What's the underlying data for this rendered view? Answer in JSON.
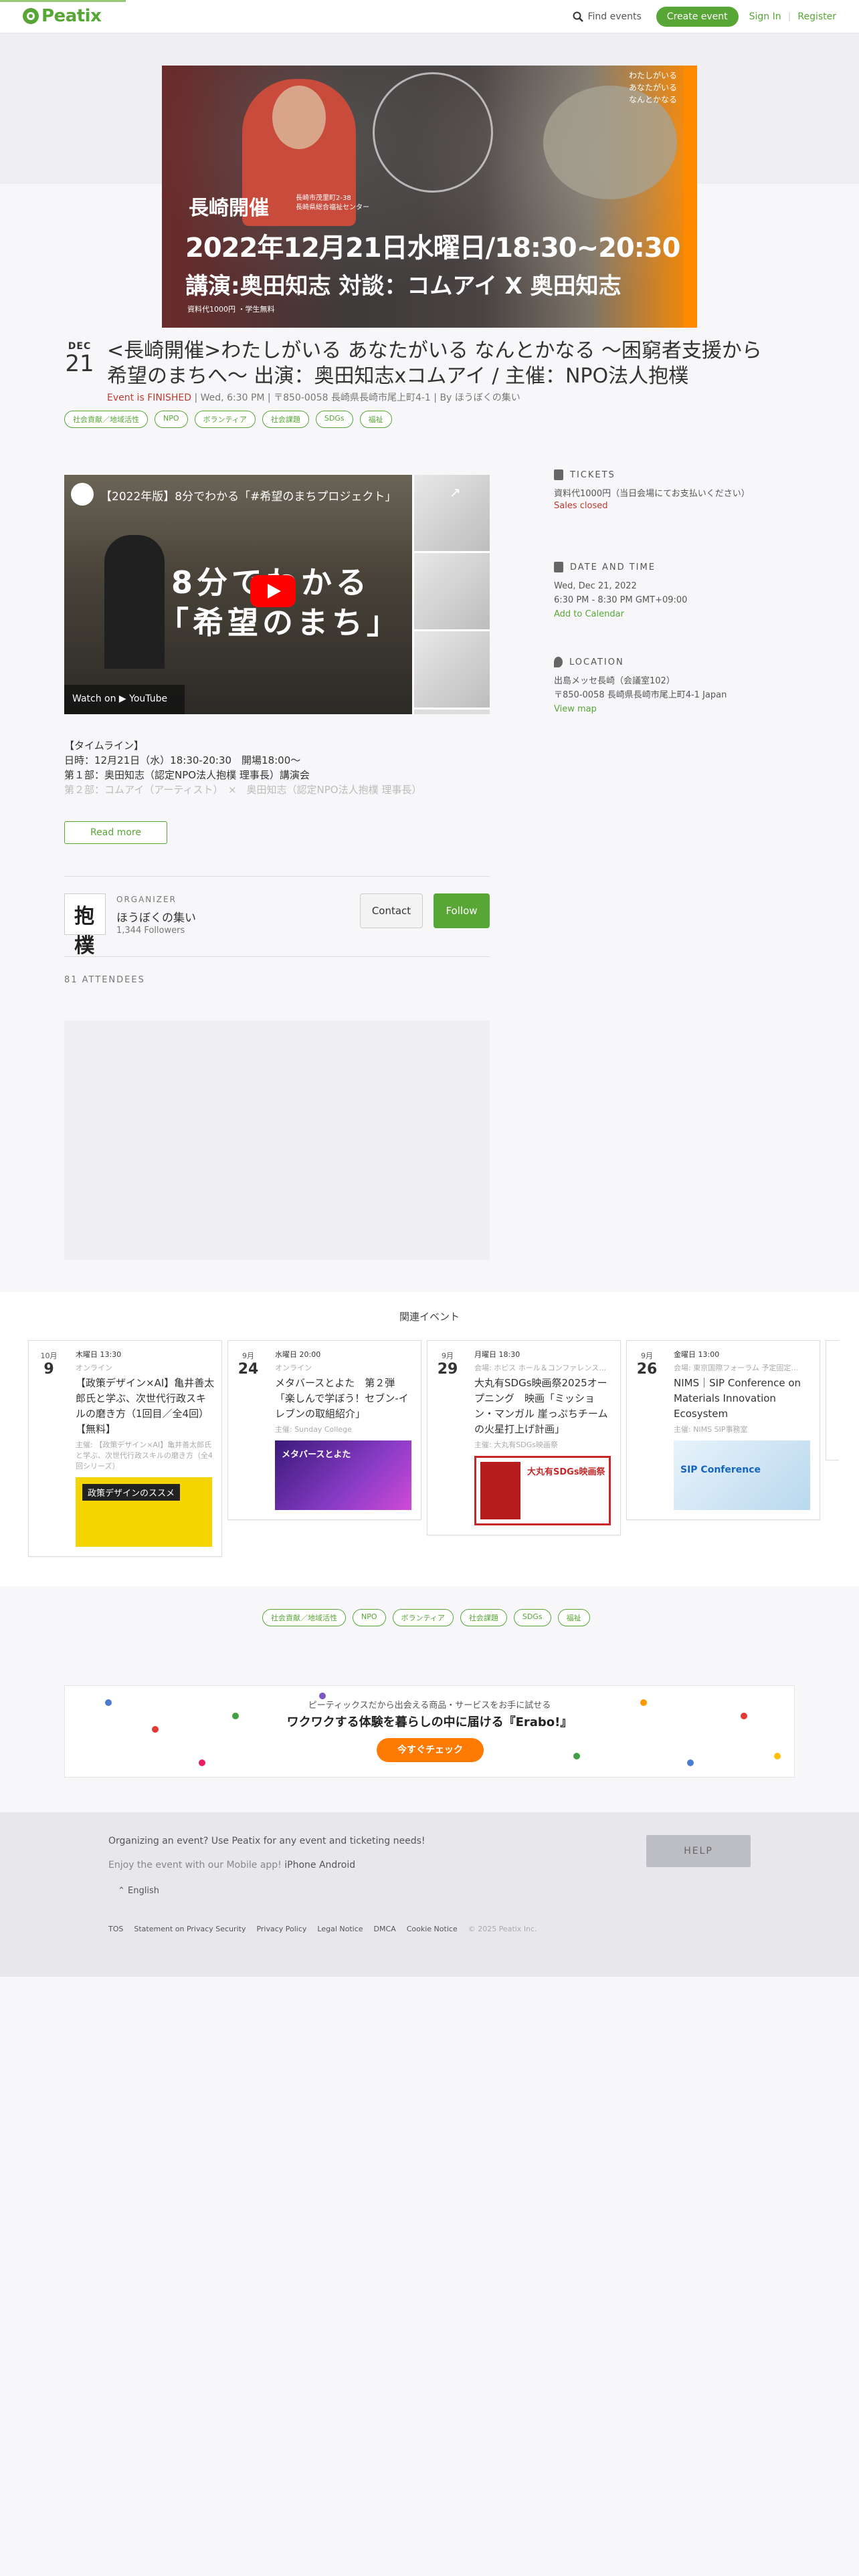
{
  "header": {
    "logo": "Peatix",
    "find_events": "Find events",
    "create_event": "Create event",
    "sign_in": "Sign In",
    "register": "Register",
    "accent": "#57a636"
  },
  "hero": {
    "top_right": [
      "わたしがいる",
      "あなたがいる",
      "なんとかなる"
    ],
    "nagasaki": "長崎開催",
    "small": [
      "長崎市茂里町2-38",
      "長崎県総合福祉センター"
    ],
    "date": "2022年12月21日水曜日/18:30~20:30",
    "speakers": "講演:奥田知志 対談：コムアイ X 奥田知志",
    "fee": "資料代1000円 ・学生無料"
  },
  "event": {
    "month": "DEC",
    "day": "21",
    "title": "<長崎開催>わたしがいる あなたがいる なんとかなる 〜困窮者支援から希望のまちへ〜 出演：奥田知志xコムアイ / 主催：NPO法人抱樸",
    "finished": "Event is FINISHED",
    "datetime": "Wed, 6:30 PM",
    "address": "〒850-0058 長崎県長崎市尾上町4-1",
    "by": "By ほうぼくの集い",
    "tags": [
      "社会貢献／地域活性",
      "NPO",
      "ボランティア",
      "社会課題",
      "SDGs",
      "福祉"
    ]
  },
  "video": {
    "title": "【2022年版】8分でわかる「#希望のまちプロジェクト」",
    "overlay1": "8分でわかる",
    "overlay2": "「希望のまち」",
    "watch": "Watch on ▶ YouTube",
    "share": "↗"
  },
  "sidebar": {
    "tickets_label": "TICKETS",
    "ticket_price": "資料代1000円（当日会場にてお支払いください）",
    "sales_closed": "Sales closed",
    "datetime_label": "DATE AND TIME",
    "date_line": "Wed, Dec 21, 2022",
    "time_line": "6:30 PM - 8:30 PM GMT+09:00",
    "add_calendar": "Add to Calendar",
    "location_label": "LOCATION",
    "venue": "出島メッセ長崎（会議室102）",
    "venue_address": "〒850-0058 長崎県長崎市尾上町4-1 Japan",
    "view_map": "View map"
  },
  "description": {
    "line1": "【タイムライン】",
    "line2": "日時：12月21日（水）18:30-20:30　開場18:00〜",
    "line3": "第１部：奥田知志（認定NPO法人抱樸 理事長）講演会",
    "line4": "第２部：コムアイ（アーティスト）　×　奥田知志（認定NPO法人抱樸 理事長）",
    "read_more": "Read more"
  },
  "organizer": {
    "label": "ORGANIZER",
    "logo_char": "抱樸",
    "name": "ほうぼくの集い",
    "followers": "1,344 Followers",
    "contact": "Contact",
    "follow": "Follow"
  },
  "attendees": {
    "label": "81 ATTENDEES"
  },
  "related": {
    "title": "関連イベント",
    "cards": [
      {
        "month": "10月",
        "day": "9",
        "when": "木曜日 13:30",
        "where": "オンライン",
        "title": "【政策デザイン×AI】亀井善太郎氏と学ぶ、次世代行政スキルの磨き方（1回目／全4回）【無料】",
        "org": "主催: 【政策デザイン×AI】亀井善太郎氏と学ぶ、次世代行政スキルの磨き方（全4回シリーズ）",
        "img_text": "政策デザインのススメ"
      },
      {
        "month": "9月",
        "day": "24",
        "when": "水曜日 20:00",
        "where": "オンライン",
        "title": "メタバースとよた　第２弾「楽しんで学ぼう！セブン-イレブンの取組紹介」",
        "org": "主催: Sunday College",
        "img_text": "メタバースとよた"
      },
      {
        "month": "9月",
        "day": "29",
        "when": "月曜日 18:30",
        "where": "会場: ホビス ホール＆コンファレンス…",
        "title": "大丸有SDGs映画祭2025オープニング　映画「ミッション・マンガル 崖っぷちチームの火星打上げ計画」",
        "org": "主催: 大丸有SDGs映画祭",
        "img_text": "大丸有SDGs映画祭"
      },
      {
        "month": "9月",
        "day": "26",
        "when": "金曜日 13:00",
        "where": "会場: 東京国際フォーラム 予定固定…",
        "title": "NIMS｜SIP Conference on Materials Innovation Ecosystem",
        "org": "主催: NIMS SIP事務室",
        "img_text": "SIP Conference"
      }
    ]
  },
  "bottom_tags": [
    "社会貢献／地域活性",
    "NPO",
    "ボランティア",
    "社会課題",
    "SDGs",
    "福祉"
  ],
  "ad": {
    "sub": "ピーティックスだから出会える商品・サービスをお手に試せる",
    "main": "ワクワクする体験を暮らしの中に届ける『Erabo!』",
    "button": "今すぐチェック"
  },
  "footer": {
    "organizing": "Organizing an event? Use Peatix for any event and ticketing needs!",
    "mobile_prefix": "Enjoy the event with our Mobile app!",
    "iphone": "iPhone",
    "android": "Android",
    "language": "⌃ English",
    "help": "HELP",
    "links": [
      "TOS",
      "Statement on Privacy Security",
      "Privacy Policy",
      "Legal Notice",
      "DMCA",
      "Cookie Notice"
    ],
    "copyright": "© 2025 Peatix Inc."
  }
}
